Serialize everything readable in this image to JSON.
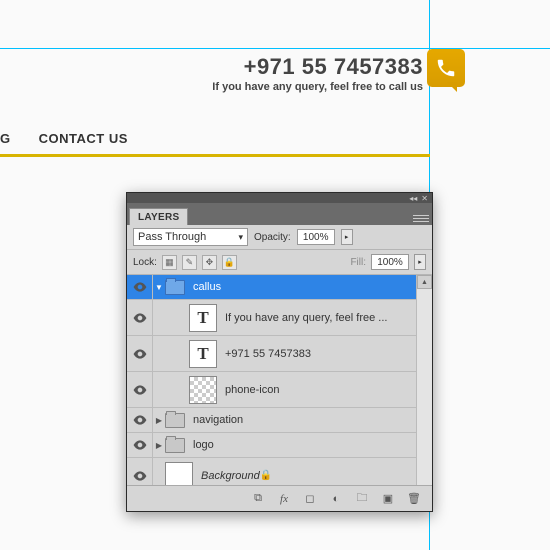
{
  "header": {
    "phone": "+971 55 7457383",
    "tagline": "If you have any query, feel free to call us"
  },
  "nav": {
    "item0": "G",
    "item1": "CONTACT US"
  },
  "panel": {
    "title": "LAYERS",
    "blend_mode": "Pass Through",
    "opacity_label": "Opacity:",
    "opacity_value": "100%",
    "lock_label": "Lock:",
    "fill_label": "Fill:",
    "fill_value": "100%"
  },
  "layers": {
    "l0": {
      "name": "callus"
    },
    "l1": {
      "name": "If you have any query, feel free ...",
      "glyph": "T"
    },
    "l2": {
      "name": "+971 55 7457383",
      "glyph": "T"
    },
    "l3": {
      "name": "phone-icon"
    },
    "l4": {
      "name": "navigation"
    },
    "l5": {
      "name": "logo"
    },
    "l6": {
      "name": "Background"
    }
  },
  "guides": {
    "v1": 429,
    "h1": 48
  }
}
